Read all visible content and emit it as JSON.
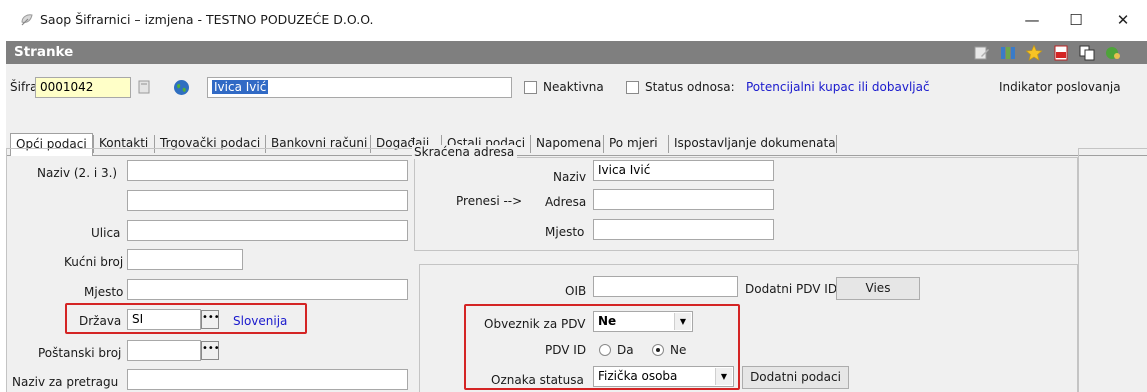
{
  "window": {
    "title": "Saop Šifrarnici – izmjena  - TESTNO PODUZEĆE D.O.O.",
    "minimize": "—",
    "maximize": "☐",
    "close": "✕"
  },
  "header": {
    "title": "Stranke",
    "toolbar_icons": [
      "edit-icon",
      "columns-icon",
      "star-icon",
      "pdf-icon",
      "copy-icon",
      "globe-user-icon"
    ]
  },
  "top_row": {
    "sifra_label": "Šifra",
    "sifra_value": "0001042",
    "name_value": "Ivica Ivić",
    "neaktivna_label": "Neaktivna",
    "status_odnosa_label": "Status odnosa:",
    "status_odnosa_link": "Potencijalni kupac ili dobavljač",
    "indikator_label": "Indikator poslovanja"
  },
  "tabs": [
    "Opći podaci",
    "Kontakti",
    "Trgovački podaci",
    "Bankovni računi",
    "Događaji",
    "Ostali podaci",
    "Napomena",
    "Po mjeri",
    "Ispostavljanje dokumenata"
  ],
  "left_form": {
    "naziv_label": "Naziv (2. i 3.)",
    "naziv_value1": "",
    "naziv_value2": "",
    "ulica_label": "Ulica",
    "ulica_value": "",
    "kucni_broj_label": "Kućni broj",
    "kucni_broj_value": "",
    "mjesto_label": "Mjesto",
    "mjesto_value": "",
    "drzava_label": "Država",
    "drzava_value": "SI",
    "drzava_link": "Slovenija",
    "postanski_broj_label": "Poštanski broj",
    "postanski_broj_value": "",
    "naziv_za_pretragu_label": "Naziv za pretragu",
    "naziv_za_pretragu_value": ""
  },
  "skracena_adresa": {
    "group_label": "Skraćena adresa",
    "naziv_label": "Naziv",
    "naziv_value": "Ivica Ivić",
    "prenesi_label": "Prenesi -->",
    "adresa_label": "Adresa",
    "adresa_value": "",
    "mjesto_label": "Mjesto",
    "mjesto_value": ""
  },
  "tax": {
    "oib_label": "OIB",
    "oib_value": "",
    "dodatni_pdv_id_button": "Dodatni PDV ID",
    "vies_button": "Vies",
    "obveznik_label": "Obveznik za PDV",
    "obveznik_value": "Ne",
    "pdv_id_label": "PDV ID",
    "pdv_id_options": [
      "Da",
      "Ne"
    ],
    "pdv_id_selected": "Ne",
    "oznaka_statusa_label": "Oznaka statusa",
    "oznaka_statusa_value": "Fizička osoba",
    "dodatni_podaci_button": "Dodatni podaci"
  },
  "colors": {
    "header_bg": "#7f7f7f",
    "highlight_box": "#d42424",
    "link": "#1a1acd",
    "sifra_bg": "#ffffc8"
  }
}
